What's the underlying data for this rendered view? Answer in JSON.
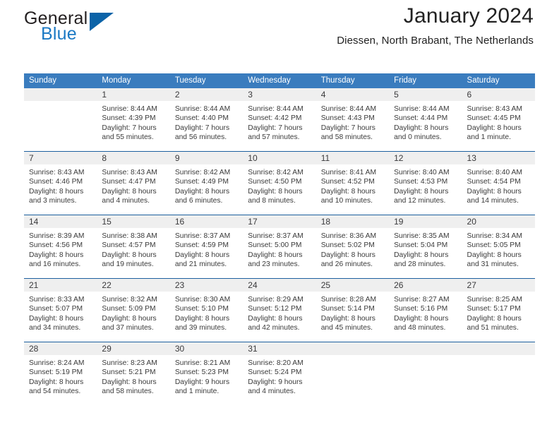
{
  "brand": {
    "name_top": "General",
    "name_bottom": "Blue",
    "colors": {
      "top_text": "#231f20",
      "bottom_text": "#1b79c4",
      "triangle": "#0b63a8"
    }
  },
  "header": {
    "title": "January 2024",
    "subtitle": "Diessen, North Brabant, The Netherlands"
  },
  "theme": {
    "header_bar": "#3a7cbe",
    "week_divider": "#1c5f9e",
    "daynum_band": "#efefef",
    "text": "#3a3a3a"
  },
  "weekdays": [
    "Sunday",
    "Monday",
    "Tuesday",
    "Wednesday",
    "Thursday",
    "Friday",
    "Saturday"
  ],
  "weeks": [
    {
      "days": [
        {
          "num": "",
          "lines": [
            "",
            "",
            "",
            ""
          ]
        },
        {
          "num": "1",
          "lines": [
            "Sunrise: 8:44 AM",
            "Sunset: 4:39 PM",
            "Daylight: 7 hours",
            "and 55 minutes."
          ]
        },
        {
          "num": "2",
          "lines": [
            "Sunrise: 8:44 AM",
            "Sunset: 4:40 PM",
            "Daylight: 7 hours",
            "and 56 minutes."
          ]
        },
        {
          "num": "3",
          "lines": [
            "Sunrise: 8:44 AM",
            "Sunset: 4:42 PM",
            "Daylight: 7 hours",
            "and 57 minutes."
          ]
        },
        {
          "num": "4",
          "lines": [
            "Sunrise: 8:44 AM",
            "Sunset: 4:43 PM",
            "Daylight: 7 hours",
            "and 58 minutes."
          ]
        },
        {
          "num": "5",
          "lines": [
            "Sunrise: 8:44 AM",
            "Sunset: 4:44 PM",
            "Daylight: 8 hours",
            "and 0 minutes."
          ]
        },
        {
          "num": "6",
          "lines": [
            "Sunrise: 8:43 AM",
            "Sunset: 4:45 PM",
            "Daylight: 8 hours",
            "and 1 minute."
          ]
        }
      ]
    },
    {
      "days": [
        {
          "num": "7",
          "lines": [
            "Sunrise: 8:43 AM",
            "Sunset: 4:46 PM",
            "Daylight: 8 hours",
            "and 3 minutes."
          ]
        },
        {
          "num": "8",
          "lines": [
            "Sunrise: 8:43 AM",
            "Sunset: 4:47 PM",
            "Daylight: 8 hours",
            "and 4 minutes."
          ]
        },
        {
          "num": "9",
          "lines": [
            "Sunrise: 8:42 AM",
            "Sunset: 4:49 PM",
            "Daylight: 8 hours",
            "and 6 minutes."
          ]
        },
        {
          "num": "10",
          "lines": [
            "Sunrise: 8:42 AM",
            "Sunset: 4:50 PM",
            "Daylight: 8 hours",
            "and 8 minutes."
          ]
        },
        {
          "num": "11",
          "lines": [
            "Sunrise: 8:41 AM",
            "Sunset: 4:52 PM",
            "Daylight: 8 hours",
            "and 10 minutes."
          ]
        },
        {
          "num": "12",
          "lines": [
            "Sunrise: 8:40 AM",
            "Sunset: 4:53 PM",
            "Daylight: 8 hours",
            "and 12 minutes."
          ]
        },
        {
          "num": "13",
          "lines": [
            "Sunrise: 8:40 AM",
            "Sunset: 4:54 PM",
            "Daylight: 8 hours",
            "and 14 minutes."
          ]
        }
      ]
    },
    {
      "days": [
        {
          "num": "14",
          "lines": [
            "Sunrise: 8:39 AM",
            "Sunset: 4:56 PM",
            "Daylight: 8 hours",
            "and 16 minutes."
          ]
        },
        {
          "num": "15",
          "lines": [
            "Sunrise: 8:38 AM",
            "Sunset: 4:57 PM",
            "Daylight: 8 hours",
            "and 19 minutes."
          ]
        },
        {
          "num": "16",
          "lines": [
            "Sunrise: 8:37 AM",
            "Sunset: 4:59 PM",
            "Daylight: 8 hours",
            "and 21 minutes."
          ]
        },
        {
          "num": "17",
          "lines": [
            "Sunrise: 8:37 AM",
            "Sunset: 5:00 PM",
            "Daylight: 8 hours",
            "and 23 minutes."
          ]
        },
        {
          "num": "18",
          "lines": [
            "Sunrise: 8:36 AM",
            "Sunset: 5:02 PM",
            "Daylight: 8 hours",
            "and 26 minutes."
          ]
        },
        {
          "num": "19",
          "lines": [
            "Sunrise: 8:35 AM",
            "Sunset: 5:04 PM",
            "Daylight: 8 hours",
            "and 28 minutes."
          ]
        },
        {
          "num": "20",
          "lines": [
            "Sunrise: 8:34 AM",
            "Sunset: 5:05 PM",
            "Daylight: 8 hours",
            "and 31 minutes."
          ]
        }
      ]
    },
    {
      "days": [
        {
          "num": "21",
          "lines": [
            "Sunrise: 8:33 AM",
            "Sunset: 5:07 PM",
            "Daylight: 8 hours",
            "and 34 minutes."
          ]
        },
        {
          "num": "22",
          "lines": [
            "Sunrise: 8:32 AM",
            "Sunset: 5:09 PM",
            "Daylight: 8 hours",
            "and 37 minutes."
          ]
        },
        {
          "num": "23",
          "lines": [
            "Sunrise: 8:30 AM",
            "Sunset: 5:10 PM",
            "Daylight: 8 hours",
            "and 39 minutes."
          ]
        },
        {
          "num": "24",
          "lines": [
            "Sunrise: 8:29 AM",
            "Sunset: 5:12 PM",
            "Daylight: 8 hours",
            "and 42 minutes."
          ]
        },
        {
          "num": "25",
          "lines": [
            "Sunrise: 8:28 AM",
            "Sunset: 5:14 PM",
            "Daylight: 8 hours",
            "and 45 minutes."
          ]
        },
        {
          "num": "26",
          "lines": [
            "Sunrise: 8:27 AM",
            "Sunset: 5:16 PM",
            "Daylight: 8 hours",
            "and 48 minutes."
          ]
        },
        {
          "num": "27",
          "lines": [
            "Sunrise: 8:25 AM",
            "Sunset: 5:17 PM",
            "Daylight: 8 hours",
            "and 51 minutes."
          ]
        }
      ]
    },
    {
      "days": [
        {
          "num": "28",
          "lines": [
            "Sunrise: 8:24 AM",
            "Sunset: 5:19 PM",
            "Daylight: 8 hours",
            "and 54 minutes."
          ]
        },
        {
          "num": "29",
          "lines": [
            "Sunrise: 8:23 AM",
            "Sunset: 5:21 PM",
            "Daylight: 8 hours",
            "and 58 minutes."
          ]
        },
        {
          "num": "30",
          "lines": [
            "Sunrise: 8:21 AM",
            "Sunset: 5:23 PM",
            "Daylight: 9 hours",
            "and 1 minute."
          ]
        },
        {
          "num": "31",
          "lines": [
            "Sunrise: 8:20 AM",
            "Sunset: 5:24 PM",
            "Daylight: 9 hours",
            "and 4 minutes."
          ]
        },
        {
          "num": "",
          "lines": [
            "",
            "",
            "",
            ""
          ]
        },
        {
          "num": "",
          "lines": [
            "",
            "",
            "",
            ""
          ]
        },
        {
          "num": "",
          "lines": [
            "",
            "",
            "",
            ""
          ]
        }
      ]
    }
  ]
}
